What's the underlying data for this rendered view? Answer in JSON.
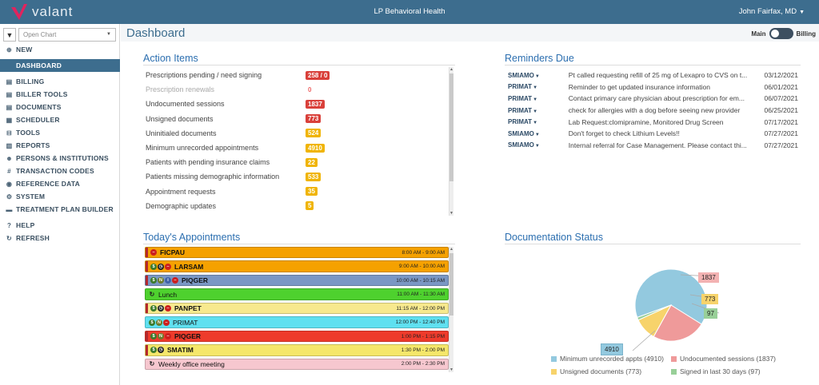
{
  "header": {
    "logo_text": "valant",
    "app_title": "LP Behavioral Health",
    "user_name": "John Fairfax, MD"
  },
  "sidebar": {
    "open_chart_placeholder": "Open Chart",
    "items": [
      {
        "label": "NEW",
        "icon": "plus-circle-icon",
        "glyph": "⊕"
      },
      {
        "label": "DASHBOARD",
        "icon": "dashboard-icon",
        "glyph": ""
      },
      {
        "label": "BILLING",
        "icon": "file-icon",
        "glyph": "▤"
      },
      {
        "label": "BILLER TOOLS",
        "icon": "file-icon",
        "glyph": "▤"
      },
      {
        "label": "DOCUMENTS",
        "icon": "file-icon",
        "glyph": "▤"
      },
      {
        "label": "SCHEDULER",
        "icon": "calendar-icon",
        "glyph": "▦"
      },
      {
        "label": "TOOLS",
        "icon": "briefcase-icon",
        "glyph": "⊟"
      },
      {
        "label": "REPORTS",
        "icon": "bar-chart-icon",
        "glyph": "▥"
      },
      {
        "label": "PERSONS & INSTITUTIONS",
        "icon": "people-icon",
        "glyph": "☻"
      },
      {
        "label": "TRANSACTION CODES",
        "icon": "hash-icon",
        "glyph": "#"
      },
      {
        "label": "REFERENCE DATA",
        "icon": "globe-icon",
        "glyph": "◉"
      },
      {
        "label": "SYSTEM",
        "icon": "gears-icon",
        "glyph": "⚙"
      },
      {
        "label": "TREATMENT PLAN BUILDER",
        "icon": "folder-icon",
        "glyph": "▬"
      },
      {
        "label": "HELP",
        "icon": "question-icon",
        "glyph": "?"
      },
      {
        "label": "REFRESH",
        "icon": "refresh-icon",
        "glyph": "↻"
      }
    ]
  },
  "main": {
    "title": "Dashboard",
    "toggle_left": "Main",
    "toggle_right": "Billing"
  },
  "action_items": {
    "title": "Action Items",
    "rows": [
      {
        "label": "Prescriptions pending / need signing",
        "value": "258 / 0",
        "color": "red"
      },
      {
        "label": "Prescription renewals",
        "value": "0",
        "color": "zero",
        "muted": true
      },
      {
        "label": "Undocumented sessions",
        "value": "1837",
        "color": "red"
      },
      {
        "label": "Unsigned documents",
        "value": "773",
        "color": "red"
      },
      {
        "label": "Uninitialed documents",
        "value": "524",
        "color": "yellow"
      },
      {
        "label": "Minimum unrecorded appointments",
        "value": "4910",
        "color": "yellow"
      },
      {
        "label": "Patients with pending insurance claims",
        "value": "22",
        "color": "yellow"
      },
      {
        "label": "Patients missing demographic information",
        "value": "533",
        "color": "yellow"
      },
      {
        "label": "Appointment requests",
        "value": "35",
        "color": "yellow"
      },
      {
        "label": "Demographic updates",
        "value": "5",
        "color": "yellow"
      }
    ]
  },
  "reminders": {
    "title": "Reminders Due",
    "rows": [
      {
        "who": "SMIAMO",
        "text": "Pt called requesting refill of 25 mg of Lexapro to CVS on t...",
        "date": "03/12/2021"
      },
      {
        "who": "PRIMAT",
        "text": "Reminder to get updated insurance information",
        "date": "06/01/2021"
      },
      {
        "who": "PRIMAT",
        "text": "Contact primary care physician about prescription for em...",
        "date": "06/07/2021"
      },
      {
        "who": "PRIMAT",
        "text": "check for allergies with a dog before seeing new provider",
        "date": "06/25/2021"
      },
      {
        "who": "PRIMAT",
        "text": "Lab Request:clomipramine, Monitored Drug Screen",
        "date": "07/17/2021"
      },
      {
        "who": "SMIAMO",
        "text": "Don't forget to check Lithium Levels!!",
        "date": "07/27/2021"
      },
      {
        "who": "SMIAMO",
        "text": "Internal referral for Case Management. Please contact thi...",
        "date": "07/27/2021"
      }
    ]
  },
  "appointments": {
    "title": "Today's Appointments",
    "rows": [
      {
        "name": "FICPAU",
        "time": "8:00 AM - 9:00 AM",
        "bg": "#f5a100",
        "bar": true,
        "icons": [
          "no"
        ],
        "bold": true
      },
      {
        "name": "LARSAM",
        "time": "9:00 AM - 10:00 AM",
        "bg": "#f5a100",
        "bar": true,
        "icons": [
          "dollar",
          "clock",
          "no"
        ],
        "bold": true
      },
      {
        "name": "PIQGER",
        "time": "10:00 AM - 10:15 AM",
        "bg": "#7a97c4",
        "bar": true,
        "icons": [
          "dollar",
          "n",
          "info",
          "no"
        ],
        "bold": true
      },
      {
        "name": "Lunch",
        "time": "11:00 AM - 11:30 AM",
        "bg": "#4ed12e",
        "bar": false,
        "icons": [
          "cycle"
        ],
        "bold": false
      },
      {
        "name": "PANPET",
        "time": "11:15 AM - 12:00 PM",
        "bg": "#f7e98e",
        "bar": true,
        "icons": [
          "dollar",
          "clock",
          "no"
        ],
        "bold": true
      },
      {
        "name": "PRIMAT",
        "time": "12:00 PM - 12:40 PM",
        "bg": "#5fe0f0",
        "bar": false,
        "icons": [
          "dollar",
          "n",
          "no"
        ],
        "bold": false
      },
      {
        "name": "PIQGER",
        "time": "1:00 PM - 1:15 PM",
        "bg": "#ee3b2b",
        "bar": true,
        "icons": [
          "dollar",
          "n",
          "no"
        ],
        "bold": true
      },
      {
        "name": "SMATIM",
        "time": "1:30 PM - 2:00 PM",
        "bg": "#f5e76a",
        "bar": true,
        "icons": [
          "dollar",
          "clock"
        ],
        "bold": true
      },
      {
        "name": "Weekly office meeting",
        "time": "2:00 PM - 2:30 PM",
        "bg": "#f6c7cf",
        "bar": false,
        "icons": [
          "cycle"
        ],
        "bold": false
      }
    ]
  },
  "documentation_status": {
    "title": "Documentation Status",
    "callouts": {
      "a": "1837",
      "b": "773",
      "c": "97",
      "d": "4910"
    },
    "legend": [
      {
        "label": "Minimum unrecorded appts (4910)",
        "color": "#93c9df"
      },
      {
        "label": "Undocumented sessions (1837)",
        "color": "#ef9a9a"
      },
      {
        "label": "Unsigned documents (773)",
        "color": "#f7d36b"
      },
      {
        "label": "Signed in last 30 days (97)",
        "color": "#98cf98"
      }
    ]
  },
  "chart_data": {
    "type": "pie",
    "title": "Documentation Status",
    "categories": [
      "Minimum unrecorded appts",
      "Undocumented sessions",
      "Unsigned documents",
      "Signed in last 30 days"
    ],
    "values": [
      4910,
      1837,
      773,
      97
    ],
    "colors": [
      "#93c9df",
      "#ef9a9a",
      "#f7d36b",
      "#98cf98"
    ],
    "legend_position": "bottom"
  }
}
